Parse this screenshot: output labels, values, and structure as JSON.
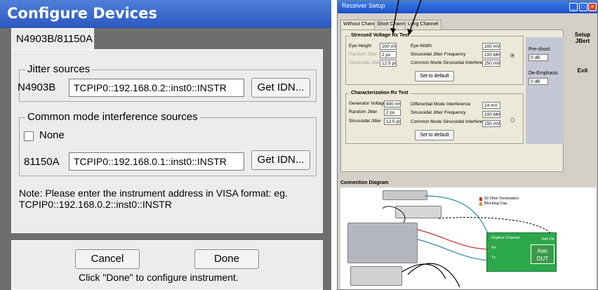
{
  "configure": {
    "title": "Configure Devices",
    "tab_label": "N4903B/81150A",
    "jitter_group_label": "Jitter sources",
    "jitter_device": "N4903B",
    "jitter_address": "TCPIP0::192.168.0.2::inst0::INSTR",
    "get_idn_label": "Get IDN...",
    "cm_group_label": "Common mode interference sources",
    "none_label": "None",
    "none_checked": false,
    "cm_device": "81150A",
    "cm_address": "TCPIP0::192.168.0.1::inst0::INSTR",
    "note": "Note: Please enter the instrument address in VISA format: eg. TCPIP0::192.168.0.2::inst0::INSTR",
    "cancel_label": "Cancel",
    "done_label": "Done",
    "hint": "Click \"Done\" to configure instrument."
  },
  "receiver": {
    "title": "Receiver Setup",
    "tabs": [
      "Without Channel",
      "Short Channel",
      "Long Channel"
    ],
    "stressed": {
      "title": "Stressed Voltage Rx Test",
      "eye_height_label": "Eye-Height",
      "eye_height": "200 mV",
      "random_jitter_label": "Random Jitter",
      "random_jitter": "2 ps",
      "sinusoidal_jitter_label": "Sinusoidal Jitter",
      "sinusoidal_jitter": "12.5 ps",
      "eye_width_label": "Eye-Width",
      "eye_width": "200 mV",
      "sj_freq_label": "Sinusoidal Jitter Frequency",
      "sj_freq": "100 MHz",
      "cm_sin_label": "Common Mode Sinusoidal Interference",
      "cm_sin": "250 mV",
      "default_label": "Set to default"
    },
    "characterization": {
      "title": "Characterization Rx Test",
      "gen_voltage_label": "Generator Voltage",
      "gen_voltage": "800 mV",
      "random_jitter_label": "Random Jitter",
      "random_jitter": "2 ps",
      "sinusoidal_jitter_label": "Sinusoidal Jitter",
      "sinusoidal_jitter": "12.5 ps",
      "diff_mode_label": "Differential Mode Interference",
      "diff_mode": "14 mV",
      "sj_freq_label": "Sinusoidal Jitter Frequency",
      "sj_freq": "100 MHz",
      "cm_sin_label": "Common Mode Sinusoidal Interference",
      "cm_sin": "150 mV",
      "default_label": "Set to default"
    },
    "preshoot_label": "Pre-shoot",
    "preshoot": "0 dB",
    "deemphasis_label": "De-Emphasis",
    "deemphasis": "0 dB",
    "setup_jbert_label": "Setup JBert",
    "exit_label": "Exit",
    "connection_title": "Connection Diagram",
    "termination_label": "50 Ohm Termination",
    "blocking_cap_label": "Blocking Cap",
    "replica_channel_label": "Replica Channel",
    "ref_clk_label": "Ref Clk",
    "rx_label": "Rx",
    "tx_label": "Tx",
    "asic_label": "Asic DUT"
  },
  "colors": {
    "title_blue": "#2a58c0",
    "dut_green": "#2ca84a",
    "cable_red": "#c03030",
    "cable_teal": "#2a8aa0"
  }
}
